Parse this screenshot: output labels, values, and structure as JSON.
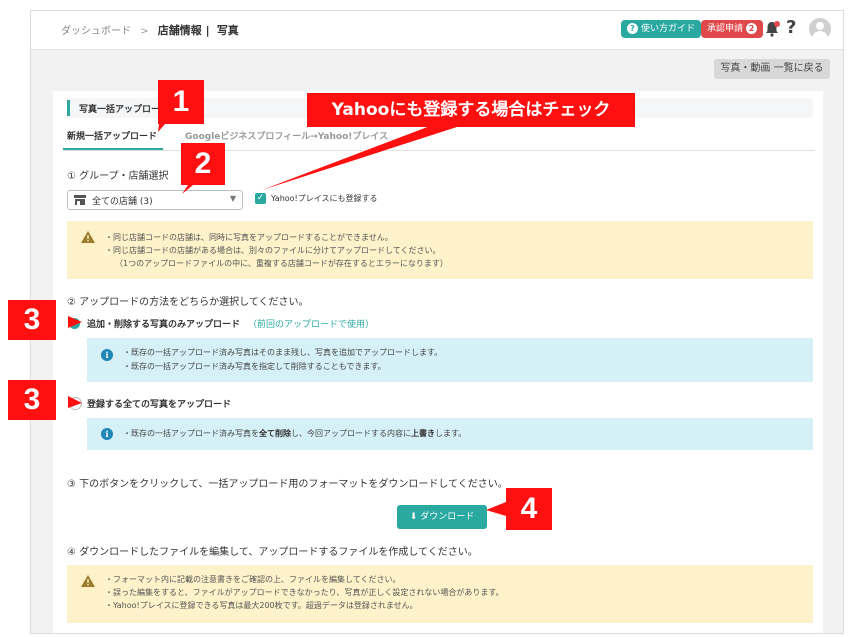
{
  "breadcrumb": {
    "home": "ダッシュボード",
    "sep": ">",
    "section": "店舗情報 |",
    "current": "写真"
  },
  "header": {
    "guide_label": "使い方ガイド",
    "approval_label": "承認申請",
    "approval_count": "2",
    "help": "?"
  },
  "back_button": "写真・動画 一覧に戻る",
  "section_title": "写真一括アップロード",
  "tabs": [
    {
      "label": "新規一括アップロード",
      "active": true
    },
    {
      "label": "Googleビジネスプロフィール→Yahoo!プレイス",
      "active": false
    }
  ],
  "step1": {
    "title": "① グループ・店舗選択",
    "select_value": "全ての店舗 (3)",
    "yahoo_checkbox_label": "Yahoo!プレイスにも登録する",
    "yahoo_checked": true
  },
  "warning1": [
    "・同じ店舗コードの店舗は、同時に写真をアップロードすることができません。",
    "・同じ店舗コードの店舗がある場合は、別々のファイルに分けてアップロードしてください。",
    "（1つのアップロードファイルの中に、重複する店舗コードが存在するとエラーになります）"
  ],
  "step2": {
    "title": "② アップロードの方法をどちらか選択してください。",
    "option1_label": "追加・削除する写真のみアップロード",
    "option1_note": "（前回のアップロードで使用）",
    "option1_info": [
      "・既存の一括アップロード済み写真はそのまま残し、写真を追加でアップロードします。",
      "・既存の一括アップロード済み写真を指定して削除することもできます。"
    ],
    "option2_label": "登録する全ての写真をアップロード",
    "option2_info_a": "・既存の一括アップロード済み写真を",
    "option2_info_b": "全て削除",
    "option2_info_c": "し、今回アップロードする内容に",
    "option2_info_d": "上書き",
    "option2_info_e": "します。"
  },
  "step3": {
    "title": "③ 下のボタンをクリックして、一括アップロード用のフォーマットをダウンロードしてください。",
    "download_label": "ダウンロード"
  },
  "step4": {
    "title": "④ ダウンロードしたファイルを編集して、アップロードするファイルを作成してください。",
    "warning": [
      "・フォーマット内に記載の注意書きをご確認の上、ファイルを編集してください。",
      "・誤った編集をすると、ファイルがアップロードできなかったり、写真が正しく設定されない場合があります。",
      "・Yahoo!プレイスに登録できる写真は最大200枚です。超過データは登録されません。"
    ]
  },
  "callouts": {
    "n1": "1",
    "n2": "2",
    "n3a": "3",
    "n3b": "3",
    "n4": "4",
    "banner": "Yahooにも登録する場合はチェック"
  },
  "colors": {
    "accent": "#2aa9a1",
    "callout": "#ff1010",
    "warn_bg": "#fdf2c9",
    "info_bg": "#d6f0f7",
    "danger": "#e0494b"
  }
}
